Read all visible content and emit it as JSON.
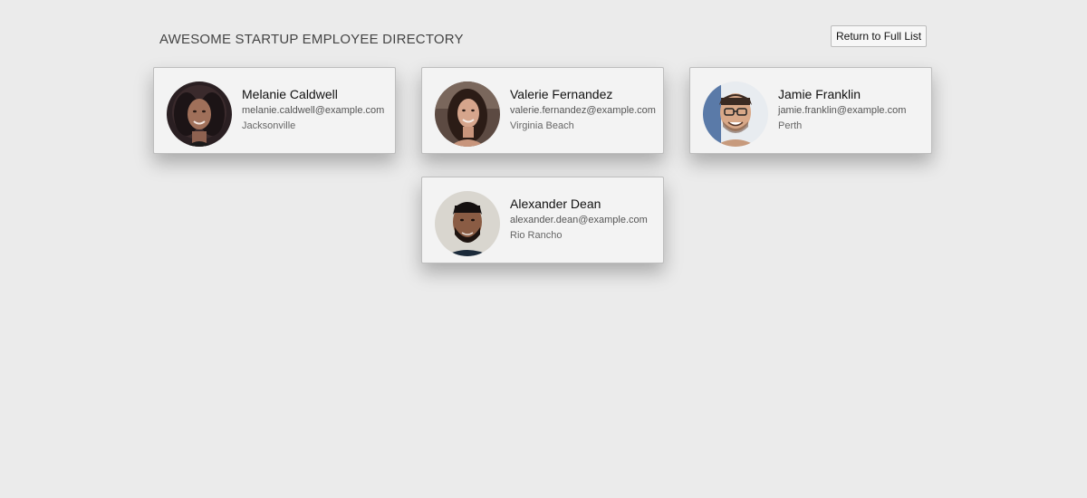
{
  "header": {
    "title": "AWESOME STARTUP EMPLOYEE DIRECTORY",
    "return_button_label": "Return to Full List"
  },
  "employees": [
    {
      "name": "Melanie Caldwell",
      "email": "melanie.caldwell@example.com",
      "city": "Jacksonville",
      "avatar": "woman-curly-hair-photo"
    },
    {
      "name": "Valerie Fernandez",
      "email": "valerie.fernandez@example.com",
      "city": "Virginia Beach",
      "avatar": "woman-long-hair-photo"
    },
    {
      "name": "Jamie Franklin",
      "email": "jamie.franklin@example.com",
      "city": "Perth",
      "avatar": "man-glasses-photo"
    },
    {
      "name": "Alexander Dean",
      "email": "alexander.dean@example.com",
      "city": "Rio Rancho",
      "avatar": "man-beard-photo"
    }
  ]
}
